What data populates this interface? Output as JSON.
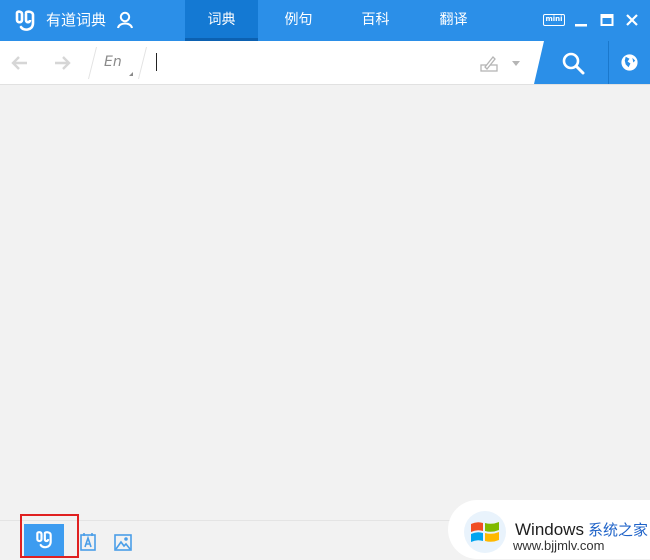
{
  "app": {
    "title": "有道词典"
  },
  "tabs": [
    {
      "label": "词典",
      "active": true
    },
    {
      "label": "例句",
      "active": false
    },
    {
      "label": "百科",
      "active": false
    },
    {
      "label": "翻译",
      "active": false
    }
  ],
  "window_controls": {
    "mini_label": "mini"
  },
  "search": {
    "lang_label": "En",
    "value": "",
    "placeholder": ""
  },
  "colors": {
    "accent": "#2b8fe8",
    "accent_dark": "#1479d3",
    "highlight_box": "#e02020"
  },
  "watermark": {
    "brand": "Windows",
    "brand_cn": "系统之家",
    "url": "www.bjjmlv.com"
  },
  "icons": {
    "logo": "youdao-logo-icon",
    "user": "user-icon",
    "back": "arrow-left-icon",
    "forward": "arrow-right-icon",
    "handwrite": "handwriting-icon",
    "search": "search-icon",
    "globe": "globe-icon",
    "minimize": "minimize-icon",
    "maximize": "maximize-icon",
    "close": "close-icon",
    "dict_mode": "youdao-logo-icon",
    "text_translate": "text-translate-icon",
    "image_translate": "image-translate-icon"
  }
}
